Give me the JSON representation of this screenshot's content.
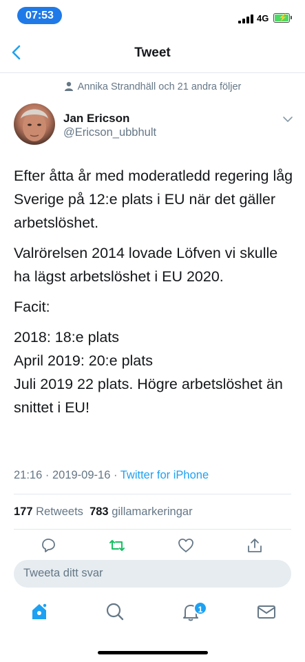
{
  "status_bar": {
    "time": "07:53",
    "network": "4G",
    "battery_color": "#4cd964"
  },
  "nav": {
    "title": "Tweet"
  },
  "social_context": "Annika Strandhäll och 21 andra följer",
  "author": {
    "name": "Jan Ericson",
    "handle": "@Ericson_ubbhult"
  },
  "tweet": {
    "paragraphs": [
      "Efter åtta år med moderatledd regering låg Sverige på 12:e plats i EU när det gäller arbetslöshet.",
      "Valrörelsen 2014 lovade Löfven vi skulle ha lägst arbetslöshet i EU 2020.",
      "Facit:",
      "2018: 18:e plats\nApril 2019: 20:e plats\nJuli 2019 22 plats. Högre arbetslöshet än snittet i EU!"
    ],
    "time": "21:16",
    "date": "2019-09-16",
    "source": "Twitter for iPhone",
    "separator": " · "
  },
  "stats": {
    "retweets_count": "177",
    "retweets_label": "Retweets",
    "likes_count": "783",
    "likes_label": "gillamarkeringar"
  },
  "reply": {
    "placeholder": "Tweeta ditt svar"
  },
  "tabbar": {
    "notifications_badge": "1"
  },
  "colors": {
    "accent": "#1da1f2",
    "retweet_active": "#17bf63",
    "muted": "#657786",
    "time_pill": "#1f7ae8"
  },
  "icons": [
    "back-chevron-icon",
    "person-icon",
    "caret-down-icon",
    "reply-icon",
    "retweet-icon",
    "like-icon",
    "share-icon",
    "home-icon",
    "search-icon",
    "notifications-icon",
    "messages-icon"
  ]
}
